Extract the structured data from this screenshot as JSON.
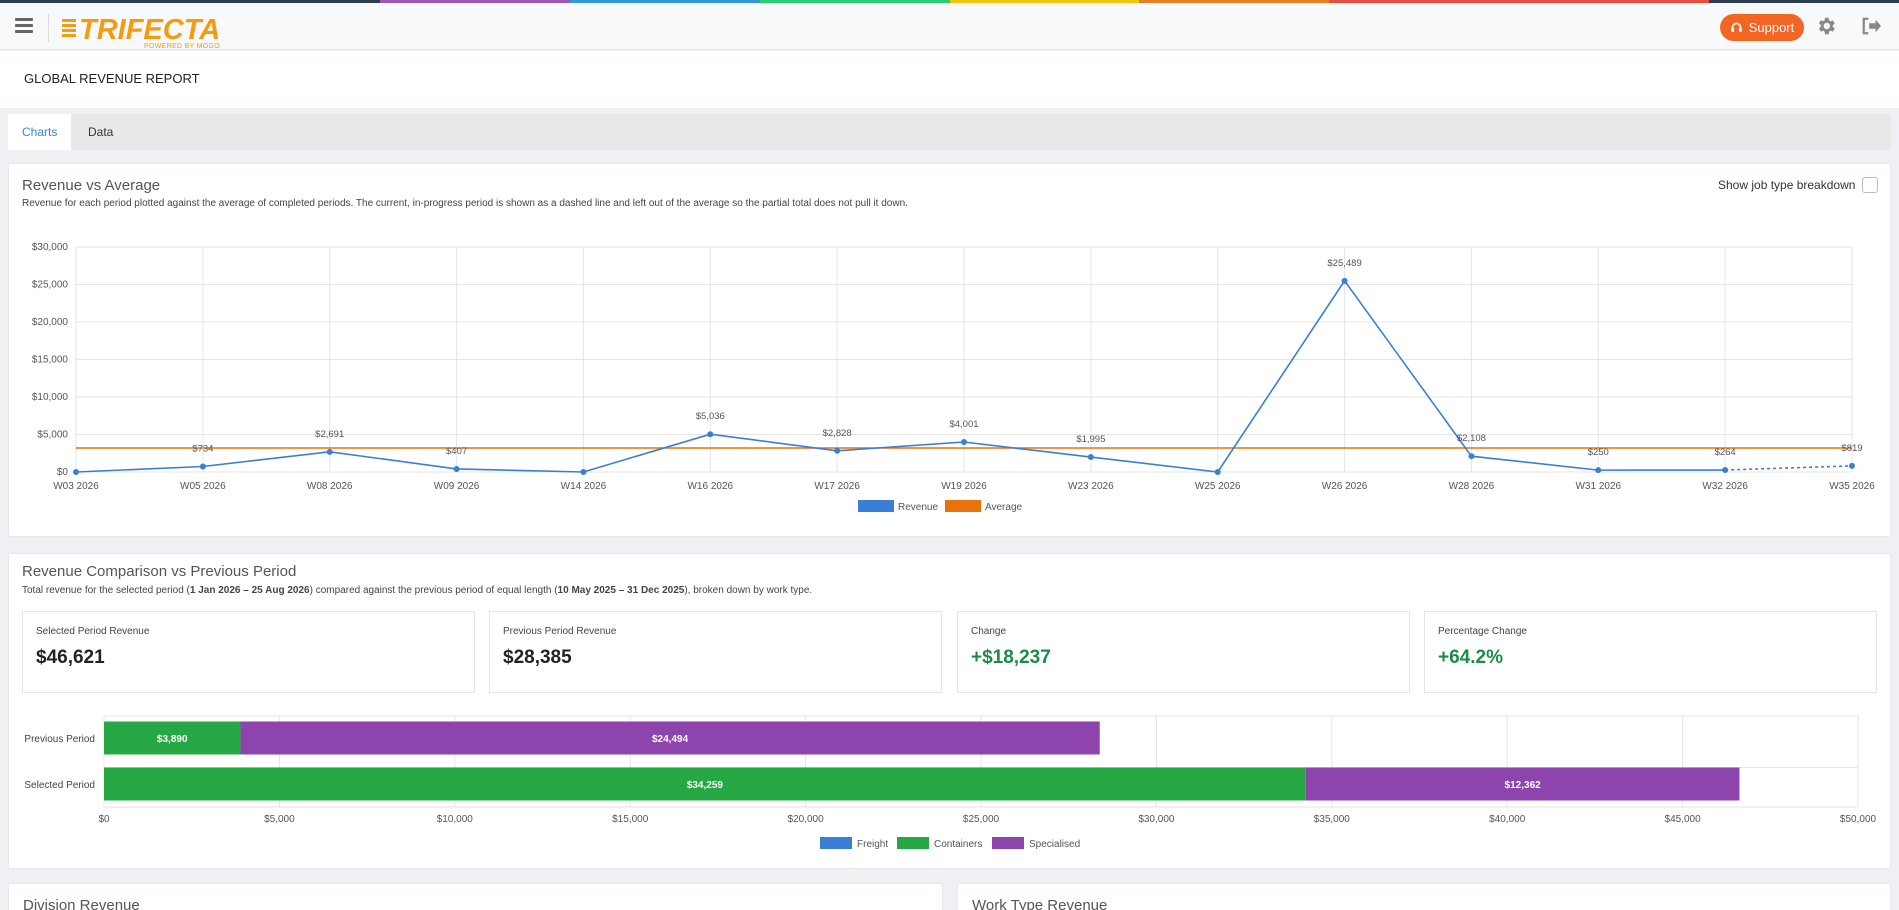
{
  "brand": {
    "name": "TRIFECTA",
    "tagline": "POWERED BY MOGO",
    "stripe_colors": [
      "#2c3e50",
      "#2c3e50",
      "#9b59b6",
      "#3498db",
      "#2ecc71",
      "#f1c40f",
      "#e67e22",
      "#e74c3c",
      "#e74c3c",
      "#2c3e50"
    ]
  },
  "header": {
    "support_label": "Support",
    "support_color": "#f26522"
  },
  "page": {
    "title": "GLOBAL REVENUE REPORT"
  },
  "tabs": [
    {
      "label": "Charts",
      "active": true
    },
    {
      "label": "Data",
      "active": false
    }
  ],
  "revenue_card": {
    "title": "Revenue vs Average",
    "description": "Revenue for each period plotted against the average of completed periods. The current, in-progress period is shown as a dashed line and left out of the average so the partial total does not pull it down.",
    "toggle_label": "Show job type breakdown",
    "toggle_checked": false
  },
  "comparison_card": {
    "title": "Revenue Comparison vs Previous Period",
    "desc_prefix": "Total revenue for the selected period (",
    "selected_range": "1 Jan 2026 – 25 Aug 2026",
    "desc_middle": ") compared against the previous period of equal length (",
    "previous_range": "10 May 2025 – 31 Dec 2025",
    "desc_suffix": "), broken down by work type.",
    "stats": [
      {
        "label": "Selected Period Revenue",
        "value": "$46,621",
        "positive": false
      },
      {
        "label": "Previous Period Revenue",
        "value": "$28,385",
        "positive": false
      },
      {
        "label": "Change",
        "value": "+$18,237",
        "positive": true
      },
      {
        "label": "Percentage Change",
        "value": "+64.2%",
        "positive": true
      }
    ]
  },
  "bottom_cards": {
    "left_title": "Division Revenue",
    "right_title": "Work Type Revenue"
  },
  "chart_data": [
    {
      "type": "line",
      "categories": [
        "W03 2026",
        "W05 2026",
        "W08 2026",
        "W09 2026",
        "W14 2026",
        "W16 2026",
        "W17 2026",
        "W19 2026",
        "W23 2026",
        "W25 2026",
        "W26 2026",
        "W28 2026",
        "W31 2026",
        "W32 2026",
        "W35 2026"
      ],
      "series": [
        {
          "name": "Revenue",
          "color": "#3a7fd5",
          "values": [
            0,
            734,
            2691,
            407,
            0,
            5036,
            2828,
            4001,
            1995,
            0,
            25489,
            2108,
            250,
            264,
            819
          ],
          "labels": [
            "",
            "$734",
            "$2,691",
            "$407",
            "",
            "$5,036",
            "$2,828",
            "$4,001",
            "$1,995",
            "",
            "$25,489",
            "$2,108",
            "$250",
            "$264",
            "$819"
          ],
          "dashed_last_segment": true
        },
        {
          "name": "Average",
          "color": "#e8720c",
          "value": 3200
        }
      ],
      "ylim": [
        0,
        30000
      ],
      "yticks": [
        "$0",
        "$5,000",
        "$10,000",
        "$15,000",
        "$20,000",
        "$25,000",
        "$30,000"
      ],
      "grid": true,
      "legend": "bottom"
    },
    {
      "type": "bar",
      "orientation": "horizontal",
      "stacked": true,
      "categories": [
        "Previous Period",
        "Selected Period"
      ],
      "series": [
        {
          "name": "Freight",
          "color": "#3a7fd5",
          "values": [
            0,
            0
          ],
          "labels": [
            "",
            ""
          ]
        },
        {
          "name": "Containers",
          "color": "#27a844",
          "values": [
            3890,
            34259
          ],
          "labels": [
            "$3,890",
            "$34,259"
          ]
        },
        {
          "name": "Specialised",
          "color": "#8e44ad",
          "values": [
            24494,
            12362
          ],
          "labels": [
            "$24,494",
            "$12,362"
          ]
        }
      ],
      "xlim": [
        0,
        50000
      ],
      "xticks": [
        "$0",
        "$5,000",
        "$10,000",
        "$15,000",
        "$20,000",
        "$25,000",
        "$30,000",
        "$35,000",
        "$40,000",
        "$45,000",
        "$50,000"
      ],
      "grid": true,
      "legend": "bottom"
    }
  ]
}
